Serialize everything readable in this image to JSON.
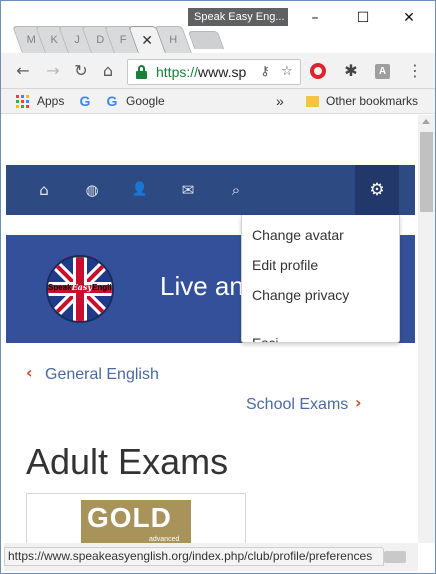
{
  "window": {
    "title_tooltip": "Speak Easy Eng...",
    "controls": [
      "–",
      "☐",
      "✕"
    ]
  },
  "tabs": [
    {
      "label": "M"
    },
    {
      "label": "K"
    },
    {
      "label": "J"
    },
    {
      "label": "D"
    },
    {
      "label": "F"
    },
    {
      "label": "✕"
    },
    {
      "label": "H"
    }
  ],
  "toolbar": {
    "back_icon": "←",
    "forward_icon": "→",
    "reload_icon": "↻",
    "home_icon": "⌂",
    "url_scheme": "https://",
    "url_rest": "www.sp",
    "key_icon": "⚷",
    "star_icon": "☆",
    "ext_letter": "A",
    "menu_icon": "⋮",
    "ext_bug_icon": "✱"
  },
  "bookmarks": {
    "apps_label": "Apps",
    "google_g": "G",
    "google_label": "Google",
    "more_icon": "»",
    "other_label": "Other bookmarks"
  },
  "site": {
    "nav_icons": [
      "⌂",
      "◍",
      "👤",
      "✉",
      "⌕"
    ],
    "gear_icon": "⚙",
    "logo_word1": "Speak",
    "logo_word2": "Easy",
    "logo_word3": "English",
    "banner_title": "Live an",
    "mobile_menu_icon": "≡",
    "dropdown": [
      "Change avatar",
      "Edit profile",
      "Change privacy",
      "Esci"
    ],
    "prev_link": "General English",
    "next_link": "School Exams",
    "prev_chev": "‹",
    "next_chev": "›",
    "page_heading": "Adult Exams",
    "card_gold": "GOLD",
    "card_sub": "advanced"
  },
  "status_url": "https://www.speakeasyenglish.org/index.php/club/profile/preferences",
  "colors": {
    "nav_bg": "#2e4a83",
    "banner_bg": "#34509a",
    "link": "#4b6aa4",
    "chevron": "#d04b22",
    "secure_green": "#188038"
  }
}
